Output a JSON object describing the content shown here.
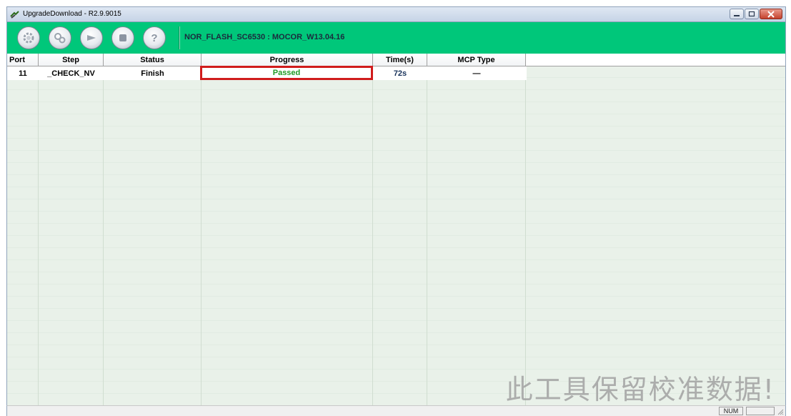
{
  "window": {
    "title": "UpgradeDownload - R2.9.9015"
  },
  "toolbar": {
    "buttons": [
      {
        "name": "settings-gear-icon"
      },
      {
        "name": "gears-icon"
      },
      {
        "name": "play-icon"
      },
      {
        "name": "stop-icon"
      },
      {
        "name": "help-icon"
      }
    ],
    "firmware_label": "NOR_FLASH_SC6530 : MOCOR_W13.04.16",
    "background": "#00c77a"
  },
  "table": {
    "columns": [
      "Port",
      "Step",
      "Status",
      "Progress",
      "Time(s)",
      "MCP Type"
    ],
    "rows": [
      {
        "port": "11",
        "step": "_CHECK_NV",
        "status": "Finish",
        "progress": "Passed",
        "time": "72s",
        "mcp_type": "—"
      }
    ],
    "passed_color": "#1f9b24",
    "highlight_color": "#d01c1c"
  },
  "watermark": "此工具保留校准数据!",
  "statusbar": {
    "num_indicator": "NUM"
  }
}
